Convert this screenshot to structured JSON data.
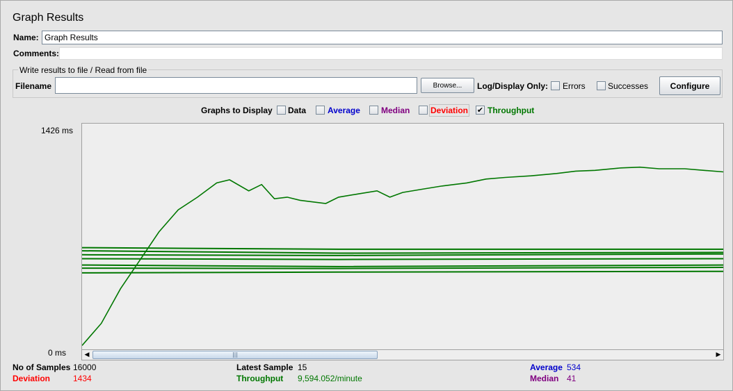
{
  "panel": {
    "title": "Graph Results"
  },
  "name_row": {
    "label": "Name:",
    "value": "Graph Results"
  },
  "comments_row": {
    "label": "Comments:",
    "value": ""
  },
  "file_group": {
    "legend": "Write results to file / Read from file",
    "filename_label": "Filename",
    "filename_value": "",
    "browse_label": "Browse...",
    "log_display_label": "Log/Display Only:",
    "errors_label": "Errors",
    "errors_checked": false,
    "successes_label": "Successes",
    "successes_checked": false,
    "configure_label": "Configure"
  },
  "graphs_to_display": {
    "label": "Graphs to Display",
    "options": [
      {
        "label": "Data",
        "checked": false,
        "color": "#000000"
      },
      {
        "label": "Average",
        "checked": false,
        "color": "#0000cc"
      },
      {
        "label": "Median",
        "checked": false,
        "color": "#800080"
      },
      {
        "label": "Deviation",
        "checked": false,
        "color": "#ff0000"
      },
      {
        "label": "Throughput",
        "checked": true,
        "color": "#007700"
      }
    ]
  },
  "graph": {
    "y_max_label": "1426  ms",
    "y_min_label": "0  ms"
  },
  "stats": {
    "samples_label": "No of Samples",
    "samples_value": "16000",
    "latest_label": "Latest Sample",
    "latest_value": "15",
    "average_label": "Average",
    "average_value": "534",
    "deviation_label": "Deviation",
    "deviation_value": "1434",
    "throughput_label": "Throughput",
    "throughput_value": "9,594.052/minute",
    "median_label": "Median",
    "median_value": "41",
    "colors": {
      "black": "#000000",
      "red": "#ff0000",
      "green": "#007700",
      "blue": "#0000cc",
      "purple": "#800080"
    }
  },
  "chart_data": {
    "type": "line",
    "ylim": [
      0,
      1426
    ],
    "ylabel": "ms",
    "series": [
      {
        "color": "#007700",
        "points": [
          [
            0,
            20
          ],
          [
            3,
            160
          ],
          [
            6,
            380
          ],
          [
            9,
            560
          ],
          [
            12,
            740
          ],
          [
            15,
            880
          ],
          [
            18,
            960
          ],
          [
            21,
            1050
          ],
          [
            23,
            1070
          ],
          [
            26,
            1000
          ],
          [
            28,
            1040
          ],
          [
            30,
            950
          ],
          [
            32,
            960
          ],
          [
            34,
            940
          ],
          [
            38,
            920
          ],
          [
            40,
            960
          ],
          [
            43,
            980
          ],
          [
            46,
            1000
          ],
          [
            48,
            960
          ],
          [
            50,
            990
          ],
          [
            53,
            1010
          ],
          [
            56,
            1030
          ],
          [
            58,
            1040
          ],
          [
            60,
            1050
          ],
          [
            63,
            1075
          ],
          [
            66,
            1085
          ],
          [
            70,
            1095
          ],
          [
            74,
            1110
          ],
          [
            77,
            1125
          ],
          [
            80,
            1130
          ],
          [
            84,
            1145
          ],
          [
            87,
            1150
          ],
          [
            90,
            1140
          ],
          [
            94,
            1140
          ],
          [
            97,
            1130
          ],
          [
            100,
            1120
          ]
        ]
      },
      {
        "color": "#007700",
        "points": [
          [
            0,
            640
          ],
          [
            40,
            630
          ],
          [
            100,
            630
          ]
        ]
      },
      {
        "color": "#007700",
        "points": [
          [
            0,
            620
          ],
          [
            40,
            605
          ],
          [
            100,
            610
          ]
        ]
      },
      {
        "color": "#007700",
        "points": [
          [
            0,
            595
          ],
          [
            40,
            590
          ],
          [
            100,
            600
          ]
        ]
      },
      {
        "color": "#007700",
        "points": [
          [
            0,
            570
          ],
          [
            40,
            565
          ],
          [
            100,
            570
          ]
        ]
      },
      {
        "color": "#007700",
        "points": [
          [
            0,
            530
          ],
          [
            40,
            520
          ],
          [
            100,
            530
          ]
        ]
      },
      {
        "color": "#007700",
        "points": [
          [
            0,
            510
          ],
          [
            40,
            508
          ],
          [
            100,
            515
          ]
        ]
      },
      {
        "color": "#007700",
        "points": [
          [
            0,
            480
          ],
          [
            40,
            485
          ],
          [
            100,
            490
          ]
        ]
      }
    ]
  }
}
